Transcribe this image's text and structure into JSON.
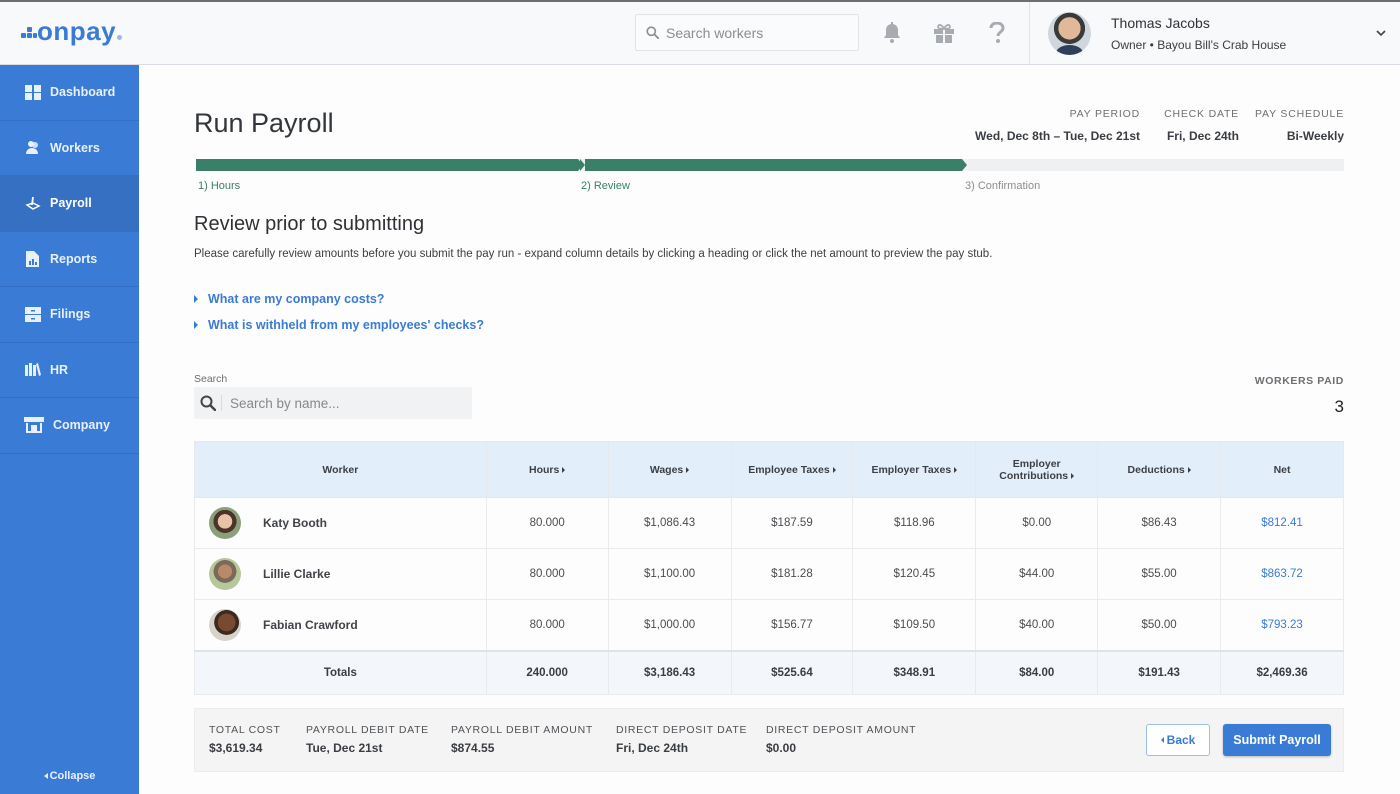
{
  "app": {
    "logo_text": "onpay",
    "brand_color": "#3a7bd5"
  },
  "topbar": {
    "search_placeholder": "Search workers",
    "icons": [
      "bell-icon",
      "gift-icon",
      "help-icon"
    ],
    "user": {
      "name": "Thomas Jacobs",
      "role": "Owner • Bayou Bill's Crab House"
    }
  },
  "sidebar": {
    "items": [
      {
        "label": "Dashboard",
        "icon": "dashboard-icon",
        "active": false
      },
      {
        "label": "Workers",
        "icon": "workers-icon",
        "active": false
      },
      {
        "label": "Payroll",
        "icon": "payroll-icon",
        "active": true
      },
      {
        "label": "Reports",
        "icon": "reports-icon",
        "active": false
      },
      {
        "label": "Filings",
        "icon": "filings-icon",
        "active": false
      },
      {
        "label": "HR",
        "icon": "hr-icon",
        "active": false
      },
      {
        "label": "Company",
        "icon": "company-icon",
        "active": false
      }
    ],
    "collapse_label": "Collapse"
  },
  "page": {
    "title": "Run Payroll",
    "meta": {
      "pay_period_label": "PAY PERIOD",
      "pay_period": "Wed, Dec 8th – Tue, Dec 21st",
      "check_date_label": "CHECK DATE",
      "check_date": "Fri, Dec 24th",
      "pay_schedule_label": "PAY SCHEDULE",
      "pay_schedule": "Bi-Weekly"
    },
    "steps": [
      {
        "label": "1) Hours",
        "status": "complete"
      },
      {
        "label": "2) Review",
        "status": "current"
      },
      {
        "label": "3) Confirmation",
        "status": "pending"
      }
    ],
    "progress_color": "#3a8068",
    "section_title": "Review prior to submitting",
    "section_desc": "Please carefully review amounts before you submit the pay run - expand column details by clicking a heading or click the net amount to preview the pay stub.",
    "expanders": [
      "What are my company costs?",
      "What is withheld from my employees' checks?"
    ],
    "search_label": "Search",
    "search_placeholder": "Search by name...",
    "workers_paid_label": "WORKERS PAID",
    "workers_paid": "3"
  },
  "table": {
    "headers": {
      "worker": "Worker",
      "hours": "Hours",
      "wages": "Wages",
      "employee_taxes": "Employee Taxes",
      "employer_taxes": "Employer Taxes",
      "employer_contrib_1": "Employer",
      "employer_contrib_2": "Contributions",
      "deductions": "Deductions",
      "net": "Net"
    },
    "rows": [
      {
        "name": "Katy Booth",
        "hours": "80.000",
        "wages": "$1,086.43",
        "employee_taxes": "$187.59",
        "employer_taxes": "$118.96",
        "employer_contributions": "$0.00",
        "deductions": "$86.43",
        "net": "$812.41"
      },
      {
        "name": "Lillie Clarke",
        "hours": "80.000",
        "wages": "$1,100.00",
        "employee_taxes": "$181.28",
        "employer_taxes": "$120.45",
        "employer_contributions": "$44.00",
        "deductions": "$55.00",
        "net": "$863.72"
      },
      {
        "name": "Fabian Crawford",
        "hours": "80.000",
        "wages": "$1,000.00",
        "employee_taxes": "$156.77",
        "employer_taxes": "$109.50",
        "employer_contributions": "$40.00",
        "deductions": "$50.00",
        "net": "$793.23"
      }
    ],
    "totals": {
      "label": "Totals",
      "hours": "240.000",
      "wages": "$3,186.43",
      "employee_taxes": "$525.64",
      "employer_taxes": "$348.91",
      "employer_contributions": "$84.00",
      "deductions": "$191.43",
      "net": "$2,469.36"
    }
  },
  "footer": {
    "total_cost_label": "TOTAL COST",
    "total_cost": "$3,619.34",
    "payroll_debit_date_label": "PAYROLL DEBIT DATE",
    "payroll_debit_date": "Tue, Dec 21st",
    "payroll_debit_amount_label": "PAYROLL DEBIT AMOUNT",
    "payroll_debit_amount": "$874.55",
    "direct_deposit_date_label": "DIRECT DEPOSIT DATE",
    "direct_deposit_date": "Fri, Dec 24th",
    "direct_deposit_amount_label": "DIRECT DEPOSIT AMOUNT",
    "direct_deposit_amount": "$0.00",
    "back_label": "Back",
    "submit_label": "Submit Payroll"
  }
}
